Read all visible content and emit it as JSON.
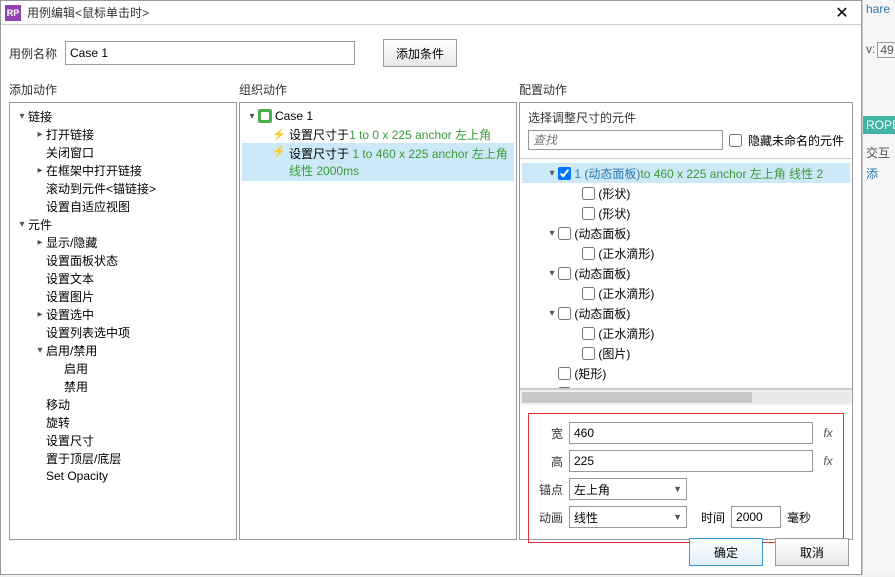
{
  "titlebar": {
    "icon_text": "RP",
    "title": "用例编辑<鼠标单击时>"
  },
  "top": {
    "label": "用例名称",
    "case_name": "Case 1",
    "add_condition": "添加条件"
  },
  "headers": {
    "a": "添加动作",
    "b": "组织动作",
    "c": "配置动作"
  },
  "actions_tree": [
    {
      "level": 0,
      "tw": "▾",
      "label": "链接"
    },
    {
      "level": 1,
      "tw": "▸",
      "label": "打开链接"
    },
    {
      "level": 1,
      "tw": "",
      "label": "关闭窗口"
    },
    {
      "level": 1,
      "tw": "▸",
      "label": "在框架中打开链接"
    },
    {
      "level": 1,
      "tw": "",
      "label": "滚动到元件<锚链接>"
    },
    {
      "level": 1,
      "tw": "",
      "label": "设置自适应视图"
    },
    {
      "level": 0,
      "tw": "▾",
      "label": "元件"
    },
    {
      "level": 1,
      "tw": "▸",
      "label": "显示/隐藏"
    },
    {
      "level": 1,
      "tw": "",
      "label": "设置面板状态"
    },
    {
      "level": 1,
      "tw": "",
      "label": "设置文本"
    },
    {
      "level": 1,
      "tw": "",
      "label": "设置图片"
    },
    {
      "level": 1,
      "tw": "▸",
      "label": "设置选中"
    },
    {
      "level": 1,
      "tw": "",
      "label": "设置列表选中项"
    },
    {
      "level": 1,
      "tw": "▾",
      "label": "启用/禁用"
    },
    {
      "level": 2,
      "tw": "",
      "label": "启用"
    },
    {
      "level": 2,
      "tw": "",
      "label": "禁用"
    },
    {
      "level": 1,
      "tw": "",
      "label": "移动"
    },
    {
      "level": 1,
      "tw": "",
      "label": "旋转"
    },
    {
      "level": 1,
      "tw": "",
      "label": "设置尺寸"
    },
    {
      "level": 1,
      "tw": "",
      "label": "置于顶层/底层"
    },
    {
      "level": 1,
      "tw": "",
      "label": "Set Opacity"
    }
  ],
  "org_tree": {
    "case_label": "Case 1",
    "a1_prefix": "设置尺寸于 ",
    "a1_green": "1 to 0 x 225 anchor 左上角",
    "a2_prefix": "设置尺寸于 ",
    "a2_green_l1": "1 to 460 x 225 anchor 左上角",
    "a2_green_l2": "线性 2000ms"
  },
  "config": {
    "heading": "选择调整尺寸的元件",
    "search_placeholder": "查找",
    "hide_unnamed": "隐藏未命名的元件",
    "widget_tree": [
      {
        "level": 0,
        "tw": "▾",
        "chk": true,
        "label_before": "1 (动态面板) ",
        "green": "to 460 x 225 anchor 左上角 线性 2",
        "sel": true
      },
      {
        "level": 1,
        "tw": "",
        "chk": false,
        "label": "(形状)"
      },
      {
        "level": 1,
        "tw": "",
        "chk": false,
        "label": "(形状)"
      },
      {
        "level": 0,
        "tw": "▾",
        "chk": false,
        "label": "(动态面板)"
      },
      {
        "level": 1,
        "tw": "",
        "chk": false,
        "label": "(正水滴形)"
      },
      {
        "level": 0,
        "tw": "▾",
        "chk": false,
        "label": "(动态面板)"
      },
      {
        "level": 1,
        "tw": "",
        "chk": false,
        "label": "(正水滴形)"
      },
      {
        "level": 0,
        "tw": "▾",
        "chk": false,
        "label": "(动态面板)"
      },
      {
        "level": 1,
        "tw": "",
        "chk": false,
        "label": "(正水滴形)"
      },
      {
        "level": 1,
        "tw": "",
        "chk": false,
        "label": "(图片)"
      },
      {
        "level": 0,
        "tw": "",
        "chk": false,
        "label": "(矩形)"
      },
      {
        "level": 0,
        "tw": "",
        "chk": false,
        "label": "(矩形)"
      }
    ],
    "form": {
      "width_label": "宽",
      "width_value": "460",
      "height_label": "高",
      "height_value": "225",
      "anchor_label": "锚点",
      "anchor_value": "左上角",
      "anim_label": "动画",
      "anim_value": "线性",
      "time_label": "时间",
      "time_value": "2000",
      "time_unit": "毫秒",
      "fx": "fx"
    }
  },
  "buttons": {
    "ok": "确定",
    "cancel": "取消"
  },
  "side": {
    "share": "hare",
    "v": "v:",
    "v_val": "49",
    "rope": "ROPE",
    "jh": "交互",
    "tj": "添"
  }
}
